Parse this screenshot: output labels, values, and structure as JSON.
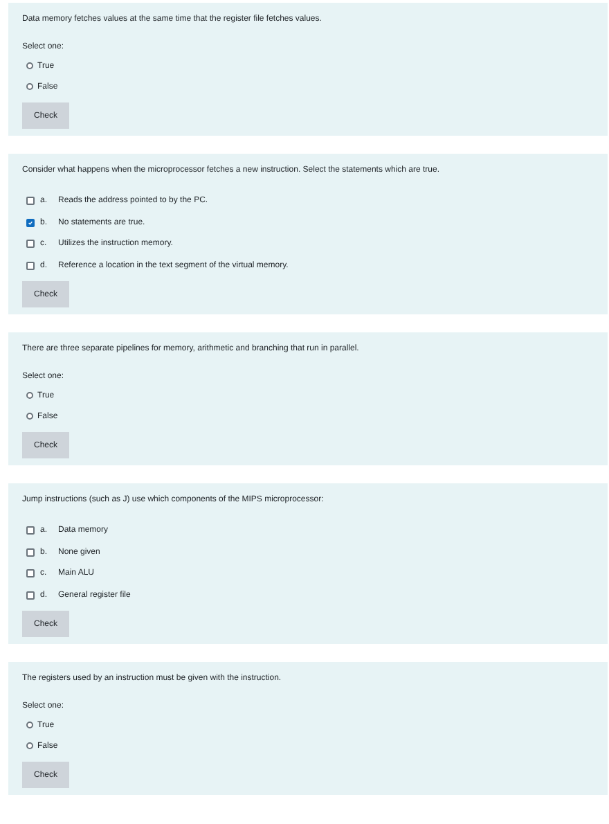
{
  "questions": [
    {
      "kind": "truefalse",
      "text": "Data memory fetches values at the same time that the register file fetches values.",
      "prompt": "Select one:",
      "options": [
        {
          "label": "True",
          "selected": false
        },
        {
          "label": "False",
          "selected": false
        }
      ],
      "button": "Check"
    },
    {
      "kind": "multi",
      "text": "Consider what happens when the microprocessor fetches a new instruction. Select the statements which are true.",
      "options": [
        {
          "letter": "a.",
          "label": "Reads the address pointed to by the PC.",
          "checked": false
        },
        {
          "letter": "b.",
          "label": "No statements are true.",
          "checked": true
        },
        {
          "letter": "c.",
          "label": "Utilizes the instruction memory.",
          "checked": false
        },
        {
          "letter": "d.",
          "label": "Reference a location in the text segment of the virtual memory.",
          "checked": false
        }
      ],
      "button": "Check"
    },
    {
      "kind": "truefalse",
      "text": "There are three separate pipelines for memory, arithmetic and branching that run in parallel.",
      "prompt": "Select one:",
      "options": [
        {
          "label": "True",
          "selected": false
        },
        {
          "label": "False",
          "selected": false
        }
      ],
      "button": "Check"
    },
    {
      "kind": "multi",
      "text": "Jump instructions (such as J) use which components of the MIPS microprocessor:",
      "options": [
        {
          "letter": "a.",
          "label": "Data memory",
          "checked": false
        },
        {
          "letter": "b.",
          "label": "None given",
          "checked": false
        },
        {
          "letter": "c.",
          "label": "Main ALU",
          "checked": false
        },
        {
          "letter": "d.",
          "label": "General register file",
          "checked": false
        }
      ],
      "button": "Check"
    },
    {
      "kind": "truefalse",
      "text": "The registers used by an instruction must be given with the instruction.",
      "prompt": "Select one:",
      "options": [
        {
          "label": "True",
          "selected": false
        },
        {
          "label": "False",
          "selected": false
        }
      ],
      "button": "Check"
    }
  ]
}
